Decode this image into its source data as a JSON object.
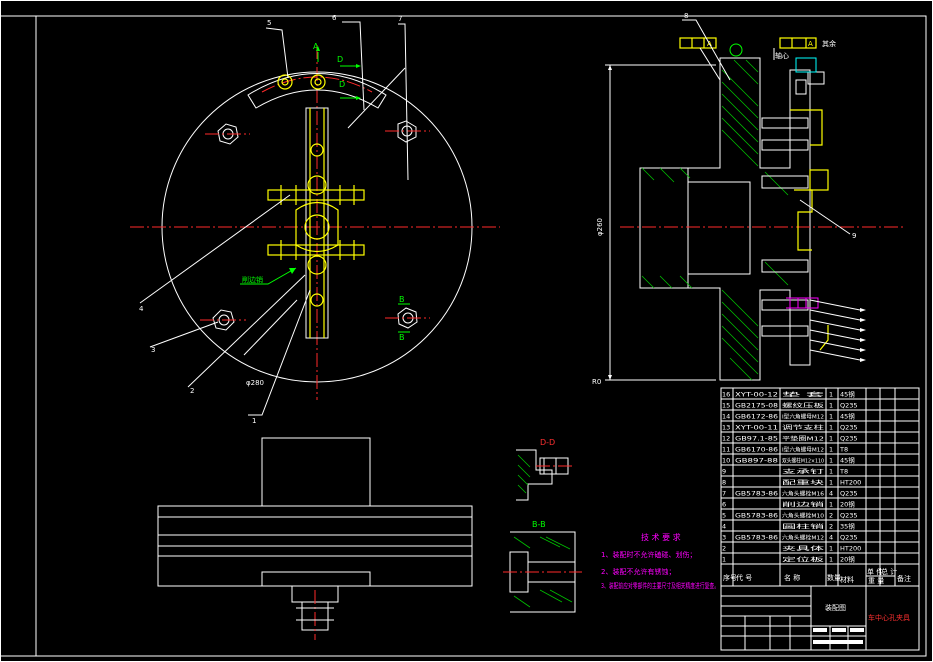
{
  "title_block": {
    "drawing_name": "装配图",
    "project_name": "车中心孔夹具"
  },
  "tech_requirements": {
    "heading": "技 术 要 求",
    "items": [
      "1、装配时不允许磕碰、划伤；",
      "2、装配不允许有锈蚀；",
      "3、装配前应对零部件的主要尺寸及相关精度进行复查。"
    ]
  },
  "section_labels": {
    "dd": "D-D",
    "bb": "B-B",
    "a_marker": "A",
    "d_marker": "D",
    "b_marker": "B"
  },
  "leaders": {
    "top": [
      "5",
      "6",
      "7"
    ],
    "left": [
      "4",
      "3",
      "2",
      "1"
    ],
    "right": [
      "8",
      "9"
    ]
  },
  "annotations": {
    "green_note": "削边销",
    "dim_left": "φ280",
    "dim_right_v": "φ260",
    "dim_bottom": "R0",
    "tolerance_a": "A",
    "roughness": "其余"
  },
  "bom_header": {
    "seq": "序号",
    "code": "代  号",
    "name": "名  称",
    "qty": "数量",
    "material": "材料",
    "unit_weight": "单 件",
    "total_weight": "总 计",
    "weight": "重  量",
    "note": "备注"
  },
  "bom": [
    {
      "seq": "16",
      "code": "XYT-00-12",
      "name": "垫  套",
      "qty": "1",
      "material": "45钢"
    },
    {
      "seq": "15",
      "code": "GB2175-08",
      "name": "螺纹压板",
      "qty": "1",
      "material": "Q235"
    },
    {
      "seq": "14",
      "code": "GB6172-86",
      "name": "I型六角螺母M12",
      "qty": "1",
      "material": "45钢"
    },
    {
      "seq": "13",
      "code": "XYT-00-11",
      "name": "调节支柱",
      "qty": "1",
      "material": "Q235"
    },
    {
      "seq": "12",
      "code": "GB97.1-85",
      "name": "平垫圈M12",
      "qty": "1",
      "material": "Q235"
    },
    {
      "seq": "11",
      "code": "GB6170-86",
      "name": "I型六角螺母M12",
      "qty": "1",
      "material": "T8"
    },
    {
      "seq": "10",
      "code": "GB897-88",
      "name": "双头螺柱M12×110",
      "qty": "1",
      "material": "45钢"
    },
    {
      "seq": "9",
      "code": "",
      "name": "支承钉",
      "qty": "1",
      "material": "T8"
    },
    {
      "seq": "8",
      "code": "",
      "name": "配重块",
      "qty": "1",
      "material": "HT200"
    },
    {
      "seq": "7",
      "code": "GB5783-86",
      "name": "六角头螺栓M16",
      "qty": "4",
      "material": "Q235"
    },
    {
      "seq": "6",
      "code": "",
      "name": "削边销",
      "qty": "1",
      "material": "20钢"
    },
    {
      "seq": "5",
      "code": "GB5783-86",
      "name": "六角头螺栓M10",
      "qty": "2",
      "material": "Q235"
    },
    {
      "seq": "4",
      "code": "",
      "name": "圆柱销",
      "qty": "2",
      "material": "35钢"
    },
    {
      "seq": "3",
      "code": "GB5783-86",
      "name": "六角头螺栓M12",
      "qty": "4",
      "material": "Q235"
    },
    {
      "seq": "2",
      "code": "",
      "name": "夹具体",
      "qty": "1",
      "material": "HT200"
    },
    {
      "seq": "1",
      "code": "",
      "name": "定位板",
      "qty": "1",
      "material": "20钢"
    }
  ]
}
